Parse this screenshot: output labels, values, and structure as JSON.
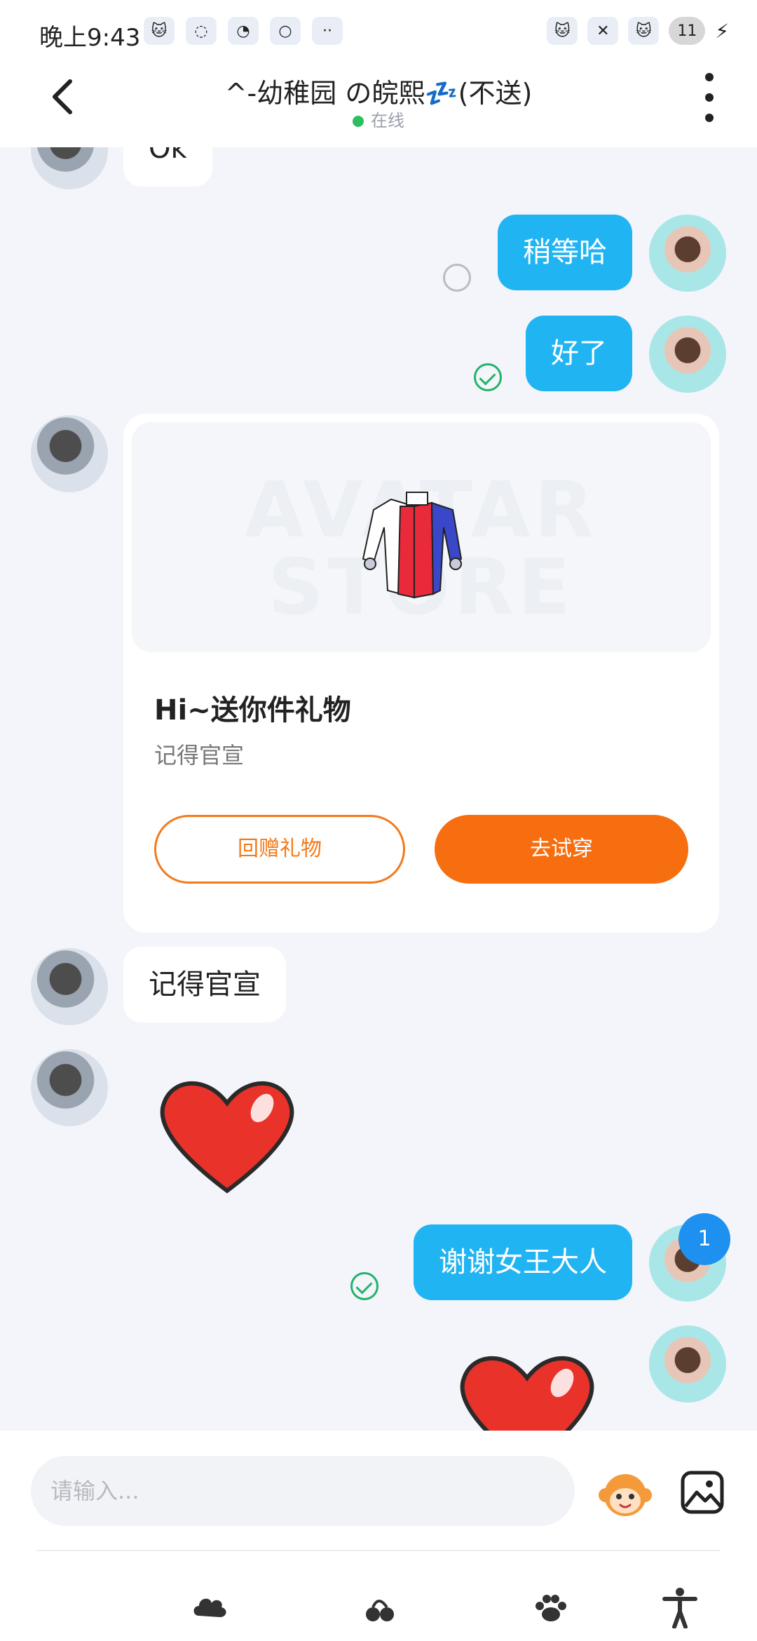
{
  "status_bar": {
    "time": "晚上9:43",
    "battery": "11"
  },
  "header": {
    "title": "^-幼稚园 の皖熙💤(不送)",
    "status": "在线"
  },
  "messages": {
    "m1": "Ok",
    "m2": "稍等哈",
    "m3": "好了",
    "m5": "记得官宣",
    "m7": "谢谢女王大人"
  },
  "gift_card": {
    "watermark_line1": "AVATAR",
    "watermark_line2": "STORE",
    "title": "Hi~送你件礼物",
    "subtitle": "记得官宣",
    "return_gift": "回赠礼物",
    "try_on": "去试穿"
  },
  "unread_count": "1",
  "composer": {
    "placeholder": "请输入..."
  },
  "colors": {
    "accent_blue": "#21b4f3",
    "gift_orange": "#f66e10",
    "online_green": "#2dbe60"
  }
}
